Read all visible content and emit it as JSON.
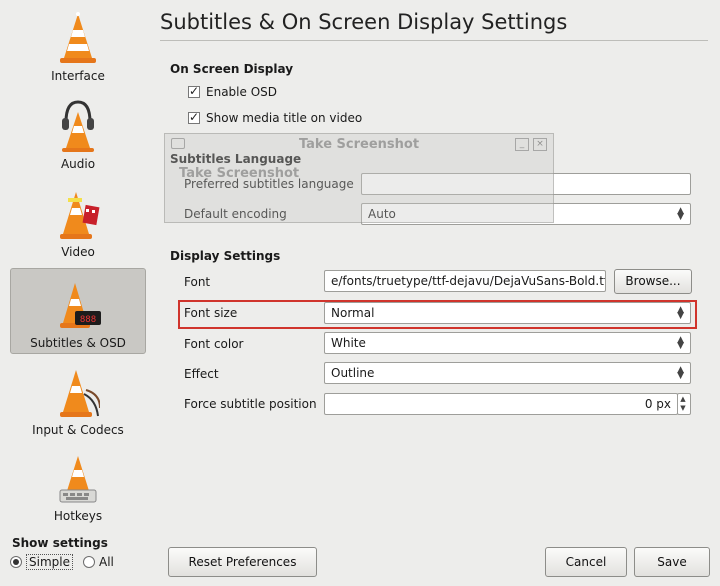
{
  "sidebar": {
    "items": [
      {
        "label": "Interface"
      },
      {
        "label": "Audio"
      },
      {
        "label": "Video"
      },
      {
        "label": "Subtitles & OSD"
      },
      {
        "label": "Input & Codecs"
      },
      {
        "label": "Hotkeys"
      }
    ],
    "show_settings_label": "Show settings",
    "simple_label": "Simple",
    "all_label": "All"
  },
  "main": {
    "title": "Subtitles & On Screen Display Settings",
    "osd": {
      "section_label": "On Screen Display",
      "enable_osd_label": "Enable OSD",
      "show_title_label": "Show media title on video"
    },
    "subtitles_lang": {
      "section_label": "Subtitles Language",
      "preferred_label": "Preferred subtitles language",
      "preferred_value": "",
      "encoding_label": "Default encoding",
      "encoding_value": "Auto"
    },
    "display": {
      "section_label": "Display Settings",
      "font_label": "Font",
      "font_value": "e/fonts/truetype/ttf-dejavu/DejaVuSans-Bold.ttf",
      "browse_label": "Browse...",
      "font_size_label": "Font size",
      "font_size_value": "Normal",
      "font_color_label": "Font color",
      "font_color_value": "White",
      "effect_label": "Effect",
      "effect_value": "Outline",
      "force_pos_label": "Force subtitle position",
      "force_pos_value": "0 px"
    }
  },
  "overlay": {
    "title": "Take Screenshot",
    "subtitle": "Take Screenshot"
  },
  "footer": {
    "reset_label": "Reset Preferences",
    "cancel_label": "Cancel",
    "save_label": "Save"
  },
  "colors": {
    "highlight": "#d0342c",
    "cone_orange": "#f08a1c"
  },
  "icons": [
    "vlc-cone-icon",
    "headphones-icon",
    "film-icon",
    "clock-display-icon",
    "cables-icon",
    "keyboard-icon",
    "checkmark-icon",
    "chevron-updown-icon",
    "camera-icon"
  ]
}
